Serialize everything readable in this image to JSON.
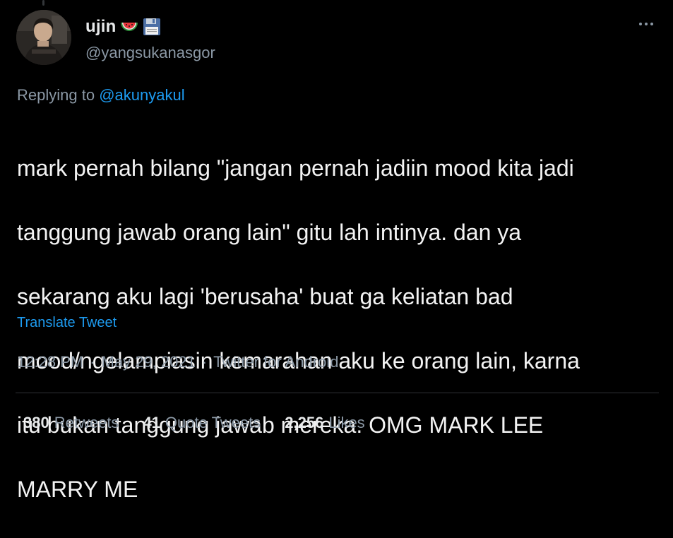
{
  "user": {
    "display_name": "ujin",
    "emojis": [
      "watermelon-emoji",
      "floppy-disk-emoji"
    ],
    "handle": "@yangsukanasgor"
  },
  "reply": {
    "prefix": "Replying to",
    "mention": "@akunyakul"
  },
  "tweet": {
    "lines": [
      "mark pernah bilang \"jangan pernah jadiin mood kita jadi",
      "tanggung jawab orang lain\" gitu lah intinya. dan ya",
      "sekarang aku lagi 'berusaha' buat ga keliatan bad",
      "mood/ngelampiasin kemarahan aku ke orang lain, karna",
      "itu bukan tanggung jawab mereka. OMG MARK LEE",
      "MARRY ME"
    ],
    "translate_label": "Translate Tweet"
  },
  "meta": {
    "time": "12:28 PM",
    "separator": "·",
    "date": "May 29, 2021",
    "source": "Twitter for Android"
  },
  "stats": {
    "retweets_count": "380",
    "retweets_label": "Retweets",
    "quotes_count": "41",
    "quotes_label": "Quote Tweets",
    "likes_count": "2,256",
    "likes_label": "Likes"
  },
  "colors": {
    "background": "#000000",
    "text": "#e7e9ea",
    "secondary": "#8b98a5",
    "link": "#1d9bf0",
    "divider": "#2f3336"
  },
  "icons": {
    "more": "more-horizontal-icon",
    "avatar": "user-avatar"
  }
}
